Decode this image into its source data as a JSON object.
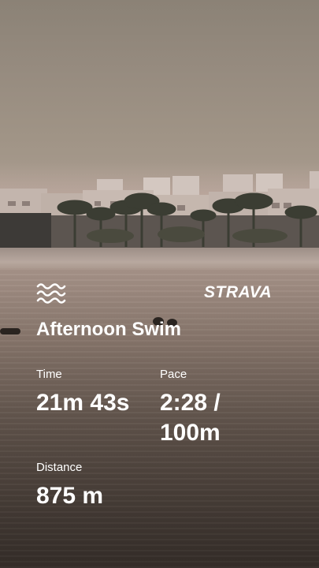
{
  "brand": {
    "name": "STRAVA",
    "sport_icon": "swim-waves-icon"
  },
  "activity": {
    "title": "Afternoon Swim"
  },
  "stats": {
    "time_label": "Time",
    "time_value": "21m 43s",
    "pace_label": "Pace",
    "pace_value_line1": "2:28 /",
    "pace_value_line2": "100m",
    "distance_label": "Distance",
    "distance_value": "875 m"
  },
  "colors": {
    "text": "#ffffff"
  }
}
